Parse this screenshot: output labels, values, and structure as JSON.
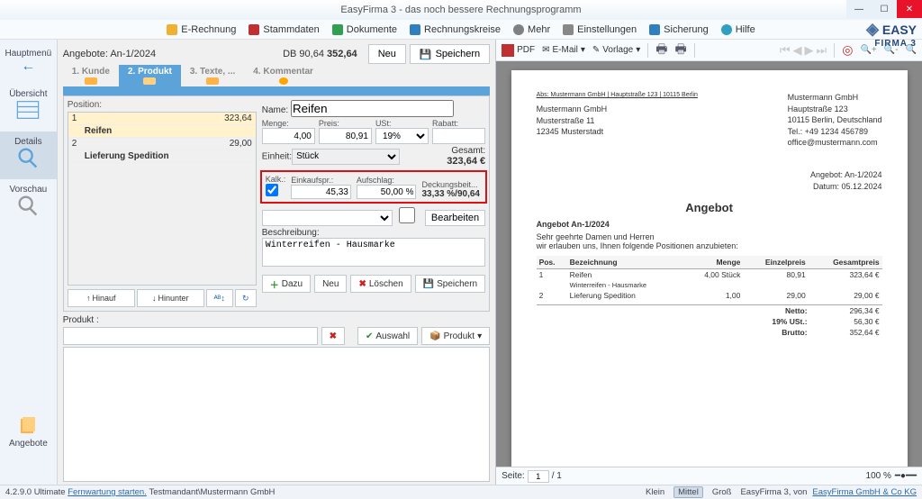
{
  "window": {
    "title": "EasyFirma 3 - das noch bessere Rechnungsprogramm"
  },
  "brand": {
    "name": "EASY",
    "sub": "FIRMA 3"
  },
  "menubar": [
    {
      "label": "E-Rechnung",
      "color": "#f0b030"
    },
    {
      "label": "Stammdaten",
      "color": "#c03030"
    },
    {
      "label": "Dokumente",
      "color": "#30a050"
    },
    {
      "label": "Rechnungskreise",
      "color": "#3080c0"
    },
    {
      "label": "Mehr",
      "color": "#808080"
    },
    {
      "label": "Einstellungen",
      "color": "#888"
    },
    {
      "label": "Sicherung",
      "color": "#3080c0"
    },
    {
      "label": "Hilfe",
      "color": "#30a0c0"
    }
  ],
  "leftnav": {
    "hauptmenu": "Hauptmenü",
    "uebersicht": "Übersicht",
    "details": "Details",
    "vorschau": "Vorschau",
    "angebote": "Angebote"
  },
  "doc": {
    "id": "Angebote: An-1/2024",
    "db_label": "DB 90,64",
    "db_total": "352,64",
    "neu": "Neu",
    "speichern": "Speichern"
  },
  "tabs": [
    {
      "label": "1. Kunde"
    },
    {
      "label": "2. Produkt"
    },
    {
      "label": "3. Texte, ..."
    },
    {
      "label": "4. Kommentar"
    }
  ],
  "positions": {
    "label": "Position:",
    "rows": [
      {
        "n": "1",
        "name": "Reifen",
        "val": "323,64"
      },
      {
        "n": "2",
        "name": "Lieferung Spedition",
        "val": "29,00"
      }
    ],
    "hinauf": "Hinauf",
    "hinunter": "Hinunter"
  },
  "form": {
    "name_label": "Name:",
    "name": "Reifen",
    "menge_label": "Menge:",
    "menge": "4,00",
    "preis_label": "Preis:",
    "preis": "80,91",
    "ust_label": "USt:",
    "ust": "19%",
    "rabatt_label": "Rabatt:",
    "rabatt": "",
    "einheit_label": "Einheit:",
    "einheit": "Stück",
    "gesamt_label": "Gesamt:",
    "gesamt": "323,64 €",
    "kalk_label": "Kalk.:",
    "einkauf_label": "Einkaufspr.:",
    "einkauf": "45,33",
    "aufschlag_label": "Aufschlag:",
    "aufschlag": "50,00 %",
    "deckung_label": "Deckungsbeit...",
    "deckung": "33,33 %/90,64",
    "bearbeiten": "Bearbeiten",
    "beschreibung_label": "Beschreibung:",
    "beschreibung": "Winterreifen - Hausmarke"
  },
  "actions": {
    "dazu": "Dazu",
    "neu": "Neu",
    "loeschen": "Löschen",
    "speichern": "Speichern"
  },
  "produkt": {
    "label": "Produkt :",
    "auswahl": "Auswahl",
    "btn": "Produkt"
  },
  "preview_tb": {
    "pdf": "PDF",
    "email": "E-Mail",
    "vorlage": "Vorlage"
  },
  "invoice": {
    "sender": "Abs: Mustermann GmbH | Hauptstraße 123 | 10115 Berlin",
    "recipient": {
      "name": "Mustermann GmbH",
      "street": "Musterstraße 11",
      "city": "12345 Musterstadt"
    },
    "company": {
      "name": "Mustermann GmbH",
      "street": "Hauptstraße 123",
      "city": "10115 Berlin, Deutschland",
      "tel": "Tel.: +49 1234 456789",
      "mail": "office@mustermann.com"
    },
    "meta": {
      "id": "Angebot: An-1/2024",
      "date": "Datum: 05.12.2024"
    },
    "title": "Angebot",
    "subtitle": "Angebot An-1/2024",
    "salutation": "Sehr geehrte Damen und Herren",
    "intro": "wir erlauben uns, Ihnen folgende Positionen anzubieten:",
    "th": {
      "pos": "Pos.",
      "bez": "Bezeichnung",
      "menge": "Menge",
      "ep": "Einzelpreis",
      "gp": "Gesamtpreis"
    },
    "lines": [
      {
        "pos": "1",
        "bez": "Reifen",
        "sub": "Winterreifen - Hausmarke",
        "menge": "4,00 Stück",
        "ep": "80,91",
        "gp": "323,64 €"
      },
      {
        "pos": "2",
        "bez": "Lieferung Spedition",
        "sub": "",
        "menge": "1,00",
        "ep": "29,00",
        "gp": "29,00 €"
      }
    ],
    "totals": {
      "netto_l": "Netto:",
      "netto": "296,34 €",
      "ust_l": "19%  USt.:",
      "ust": "56,30 €",
      "brutto_l": "Brutto:",
      "brutto": "352,64 €"
    }
  },
  "preview_footer": {
    "seite": "Seite:",
    "cur": "1",
    "total": "/ 1",
    "zoom": "100 %"
  },
  "status": {
    "version": "4.2.9.0 Ultimate",
    "fernwartung": "Fernwartung starten.",
    "mandant": "Testmandant\\Mustermann GmbH",
    "klein": "Klein",
    "mittel": "Mittel",
    "gross": "Groß",
    "prod": "EasyFirma 3, von",
    "vendor": "EasyFirma GmbH & Co KG"
  }
}
